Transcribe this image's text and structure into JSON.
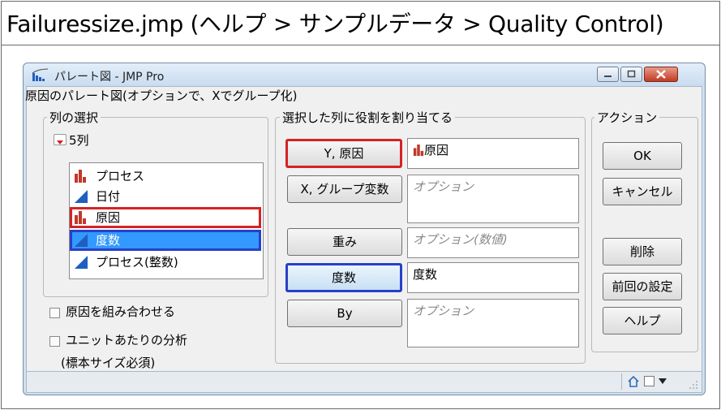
{
  "caption": "Failuressize.jmp (ヘルプ > サンプルデータ > Quality Control)",
  "window": {
    "title": "パレート図 - JMP Pro",
    "subtitle": "原因のパレート図(オプションで、Xでグループ化)"
  },
  "select_columns": {
    "legend": "列の選択",
    "count_label": "5列",
    "columns": [
      {
        "label": "プロセス",
        "type": "nominal"
      },
      {
        "label": "日付",
        "type": "continuous"
      },
      {
        "label": "原因",
        "type": "nominal",
        "highlight": "red"
      },
      {
        "label": "度数",
        "type": "continuous",
        "highlight": "blue",
        "selected": true
      },
      {
        "label": "プロセス(整数)",
        "type": "continuous"
      }
    ],
    "options": [
      {
        "label": "原因を組み合わせる",
        "checked": false
      },
      {
        "label": "ユニットあたりの分析",
        "checked": false
      }
    ],
    "note": "(標本サイズ必須)"
  },
  "cast_roles": {
    "legend": "選択した列に役割を割り当てる",
    "roles": [
      {
        "button": "Y, 原因",
        "value": "原因",
        "placeholder": ""
      },
      {
        "button": "X, グループ変数",
        "value": "",
        "placeholder": "オプション"
      },
      {
        "button": "重み",
        "value": "",
        "placeholder": "オプション(数値)"
      },
      {
        "button": "度数",
        "value": "度数",
        "placeholder": ""
      },
      {
        "button": "By",
        "value": "",
        "placeholder": "オプション"
      }
    ]
  },
  "actions": {
    "legend": "アクション",
    "ok": "OK",
    "cancel": "キャンセル",
    "remove": "削除",
    "recall": "前回の設定",
    "help": "ヘルプ"
  },
  "colors": {
    "highlight_red": "#d42323",
    "highlight_blue": "#2740c8",
    "selection": "#3399ff",
    "nominal_icon": "#c0392b",
    "continuous_icon": "#1f5fbf"
  }
}
